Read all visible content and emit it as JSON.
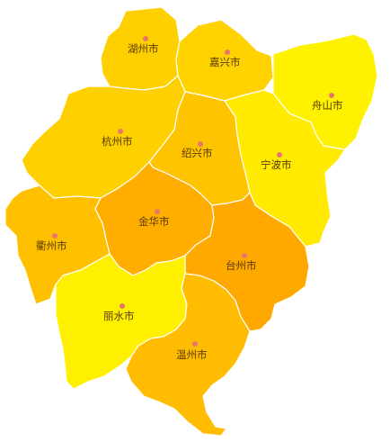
{
  "map": {
    "dot_color": "#e9766a",
    "regions": [
      {
        "id": "huzhou",
        "name": "湖州市",
        "color": "#ffd000"
      },
      {
        "id": "jiaxing",
        "name": "嘉兴市",
        "color": "#ffd200"
      },
      {
        "id": "zhoushan",
        "name": "舟山市",
        "color": "#fff200"
      },
      {
        "id": "hangzhou",
        "name": "杭州市",
        "color": "#ffd000"
      },
      {
        "id": "shaoxing",
        "name": "绍兴市",
        "color": "#ffc400"
      },
      {
        "id": "ningbo",
        "name": "宁波市",
        "color": "#ffea00"
      },
      {
        "id": "jinhua",
        "name": "金华市",
        "color": "#ffae00"
      },
      {
        "id": "quzhou",
        "name": "衢州市",
        "color": "#ffc000"
      },
      {
        "id": "taizhou",
        "name": "台州市",
        "color": "#ffa800"
      },
      {
        "id": "lishui",
        "name": "丽水市",
        "color": "#fff000"
      },
      {
        "id": "wenzhou",
        "name": "温州市",
        "color": "#ffbc00"
      }
    ]
  }
}
